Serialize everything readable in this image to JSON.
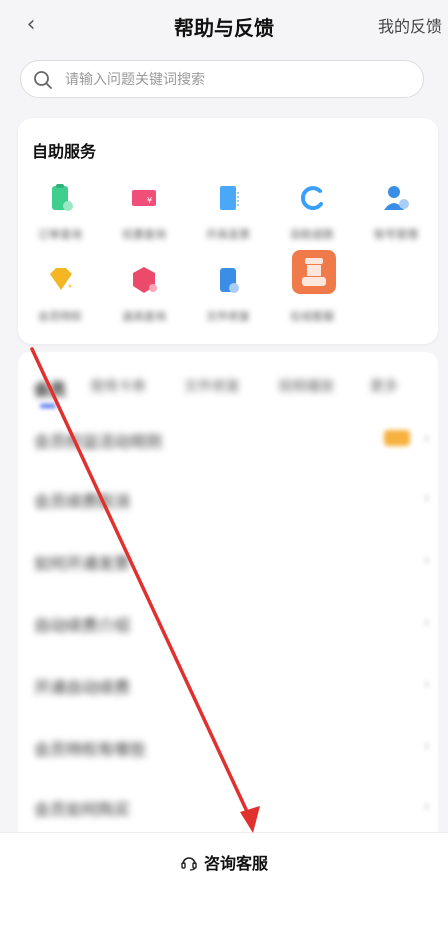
{
  "header": {
    "back_glyph": "‹",
    "title": "帮助与反馈",
    "my_feedback": "我的反馈"
  },
  "search": {
    "placeholder": "请输入问题关键词搜索"
  },
  "self_service": {
    "title": "自助服务",
    "items": [
      {
        "label": "订单查询",
        "icon": "green-doc-icon",
        "color": "#3ecf8e"
      },
      {
        "label": "优惠查询",
        "icon": "pink-ticket-icon",
        "color": "#ef4f79"
      },
      {
        "label": "开具发票",
        "icon": "blue-receipt-icon",
        "color": "#4aa8f7"
      },
      {
        "label": "自助退款",
        "icon": "blue-refresh-icon",
        "color": "#3aa0ff"
      },
      {
        "label": "账号管理",
        "icon": "user-settings-icon",
        "color": "#3a8ee6"
      },
      {
        "label": "会员特权",
        "icon": "gold-diamond-icon",
        "color": "#f5b624"
      },
      {
        "label": "道具查询",
        "icon": "pink-cube-icon",
        "color": "#ec4a6a"
      },
      {
        "label": "文件修复",
        "icon": "blue-file-icon",
        "color": "#3a8ee6"
      },
      {
        "label": "在线客服",
        "icon": "customer-service-icon",
        "color": "#f07a4a"
      }
    ]
  },
  "tabs": [
    "会员",
    "使用卡券",
    "文件修复",
    "视频播放",
    "更多"
  ],
  "faq": [
    {
      "q": "会员权益活动规则",
      "hot": true
    },
    {
      "q": "会员续费取消"
    },
    {
      "q": "如何开通发票"
    },
    {
      "q": "自动续费介绍"
    },
    {
      "q": "开通自动续费"
    },
    {
      "q": "会员特权有哪些"
    },
    {
      "q": "会员如何购买"
    }
  ],
  "bottom": {
    "customer_service": "咨询客服"
  }
}
